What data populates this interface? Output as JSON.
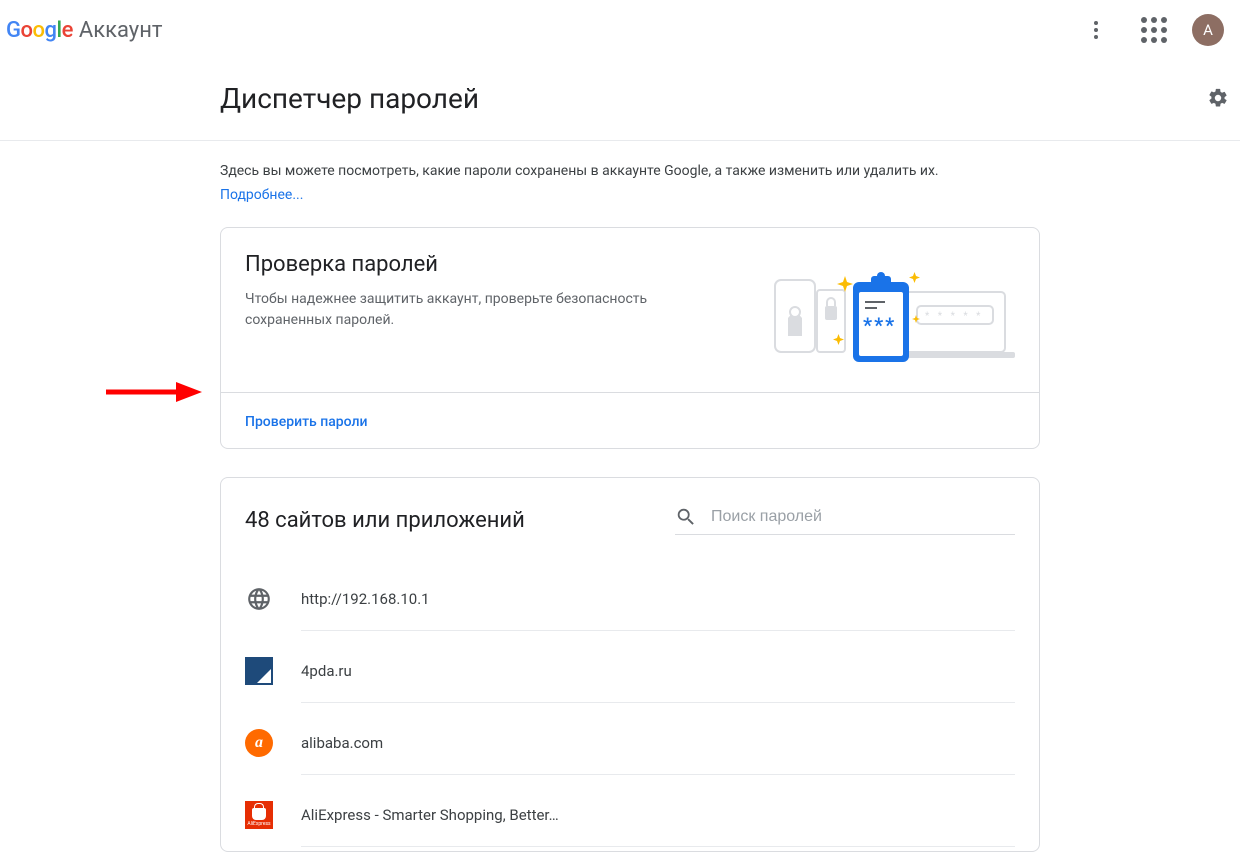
{
  "header": {
    "logo_letters": [
      "G",
      "o",
      "o",
      "g",
      "l",
      "e"
    ],
    "product": "Аккаунт",
    "avatar_letter": "А"
  },
  "title": "Диспетчер паролей",
  "intro": "Здесь вы можете посмотреть, какие пароли сохранены в аккаунте Google, а также изменить или удалить их.",
  "learn_more": "Подробнее...",
  "checkup": {
    "title": "Проверка паролей",
    "desc": "Чтобы надежнее защитить аккаунт, проверьте безопасность сохраненных паролей.",
    "cta": "Проверить пароли"
  },
  "list": {
    "title": "48 сайтов или приложений",
    "search_placeholder": "Поиск паролей",
    "items": [
      {
        "label": "http://192.168.10.1",
        "icon": "globe"
      },
      {
        "label": "4pda.ru",
        "icon": "4pda"
      },
      {
        "label": "alibaba.com",
        "icon": "alibaba"
      },
      {
        "label": "AliExpress - Smarter Shopping, Better…",
        "icon": "aliexpress"
      }
    ]
  }
}
